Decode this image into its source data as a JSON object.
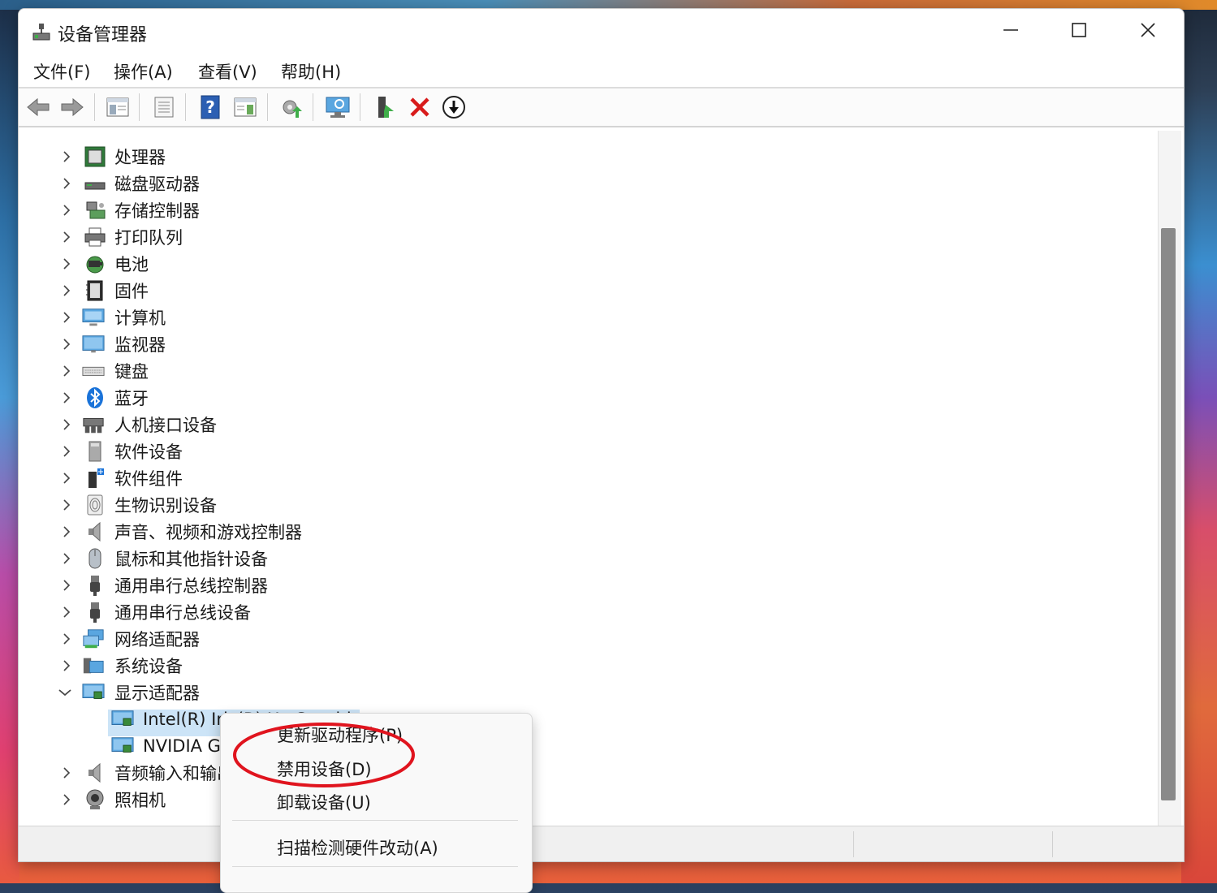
{
  "window": {
    "title": "设备管理器"
  },
  "menu": [
    "文件(F)",
    "操作(A)",
    "查看(V)",
    "帮助(H)"
  ],
  "tree": [
    {
      "label": "处理器",
      "icon": "processor-icon",
      "expanded": false
    },
    {
      "label": "磁盘驱动器",
      "icon": "disk-drive-icon",
      "expanded": false
    },
    {
      "label": "存储控制器",
      "icon": "storage-controller-icon",
      "expanded": false
    },
    {
      "label": "打印队列",
      "icon": "printer-icon",
      "expanded": false
    },
    {
      "label": "电池",
      "icon": "battery-icon",
      "expanded": false
    },
    {
      "label": "固件",
      "icon": "firmware-icon",
      "expanded": false
    },
    {
      "label": "计算机",
      "icon": "computer-icon",
      "expanded": false
    },
    {
      "label": "监视器",
      "icon": "monitor-icon",
      "expanded": false
    },
    {
      "label": "键盘",
      "icon": "keyboard-icon",
      "expanded": false
    },
    {
      "label": "蓝牙",
      "icon": "bluetooth-icon",
      "expanded": false
    },
    {
      "label": "人机接口设备",
      "icon": "hid-icon",
      "expanded": false
    },
    {
      "label": "软件设备",
      "icon": "software-device-icon",
      "expanded": false
    },
    {
      "label": "软件组件",
      "icon": "software-component-icon",
      "expanded": false
    },
    {
      "label": "生物识别设备",
      "icon": "biometric-icon",
      "expanded": false
    },
    {
      "label": "声音、视频和游戏控制器",
      "icon": "speaker-icon",
      "expanded": false
    },
    {
      "label": "鼠标和其他指针设备",
      "icon": "mouse-icon",
      "expanded": false
    },
    {
      "label": "通用串行总线控制器",
      "icon": "usb-icon",
      "expanded": false
    },
    {
      "label": "通用串行总线设备",
      "icon": "usb-device-icon",
      "expanded": false
    },
    {
      "label": "网络适配器",
      "icon": "network-adapter-icon",
      "expanded": false
    },
    {
      "label": "系统设备",
      "icon": "system-device-icon",
      "expanded": false
    },
    {
      "label": "显示适配器",
      "icon": "display-adapter-icon",
      "expanded": true,
      "children": [
        "Intel(R) Iris(R) Xe Graphics",
        "NVIDIA GeForce"
      ]
    },
    {
      "label": "音频输入和输出",
      "icon": "audio-io-icon",
      "expanded": false
    },
    {
      "label": "照相机",
      "icon": "camera-icon",
      "expanded": false
    }
  ],
  "context_menu": {
    "items": [
      "更新驱动程序(P)",
      "禁用设备(D)",
      "卸载设备(U)",
      "扫描检测硬件改动(A)"
    ]
  },
  "colors": {
    "annotation": "#e0141e",
    "selection": "#cce4f7",
    "delete_x": "#d81b1b"
  }
}
